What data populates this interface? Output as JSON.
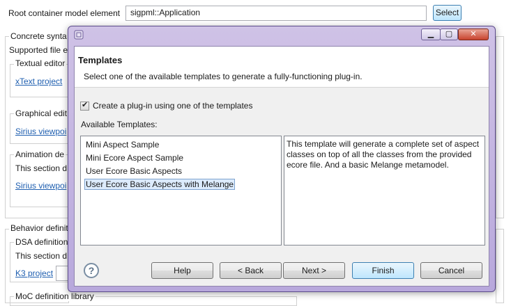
{
  "background": {
    "root_container_label": "Root container model element",
    "root_container_value": "sigpml::Application",
    "select_label": "Select",
    "concrete_syntax_label": "Concrete synta",
    "supported_file_label": "Supported file e",
    "textual_editor_label": "Textual editor",
    "xtext_link": "xText project",
    "graphical_editor_label": "Graphical edit",
    "sirius_viewpoint_link_1": "Sirius viewpoi",
    "animation_label": "Animation de",
    "animation_desc": "This section d",
    "sirius_viewpoint_link_2": "Sirius viewpoi",
    "behavior_label": "Behavior definit",
    "dsa_label": "DSA definition",
    "dsa_desc": "This section d",
    "k3_link": "K3 project",
    "moc_label": "MoC definition library"
  },
  "dialog": {
    "title": "",
    "header_title": "Templates",
    "header_description": "Select one of the available templates to generate a fully-functioning plug-in.",
    "checkbox_label": "Create a plug-in using one of the templates",
    "checkbox_checked": true,
    "available_label": "Available Templates:",
    "templates": [
      "Mini Aspect Sample",
      "Mini Ecore Aspect Sample",
      "User Ecore Basic Aspects",
      "User Ecore Basic Aspects with Melange"
    ],
    "selected_index": 3,
    "description": "This template will generate a complete set of aspect classes on top of all the classes from the provided ecore file. And a basic Melange metamodel.",
    "help_icon": "question-mark-icon",
    "buttons": {
      "help": "Help",
      "back": "< Back",
      "next": "Next >",
      "finish": "Finish",
      "cancel": "Cancel"
    }
  }
}
